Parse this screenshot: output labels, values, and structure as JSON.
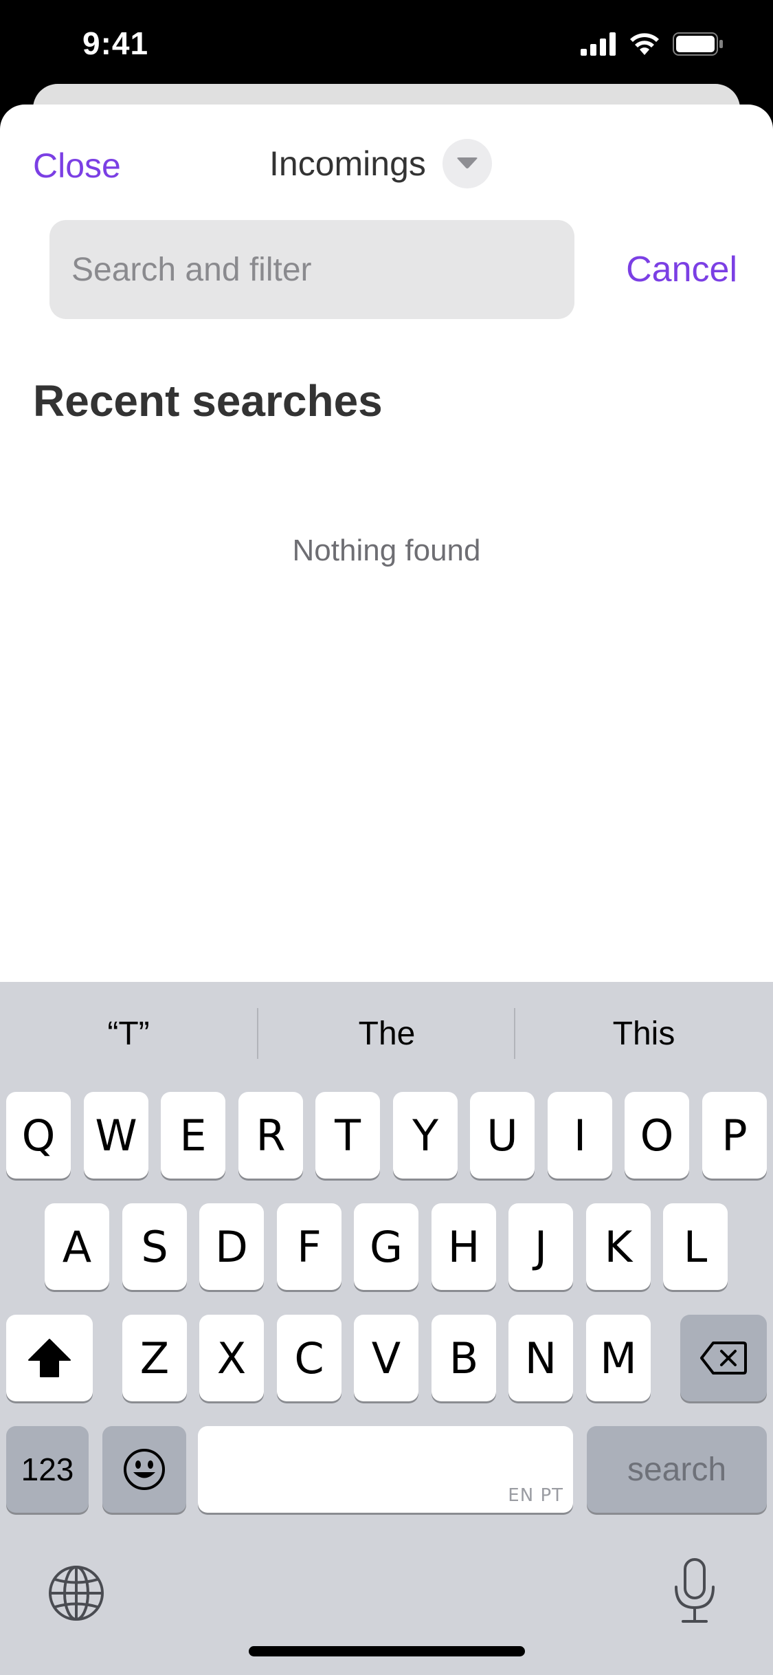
{
  "status_bar": {
    "time": "9:41"
  },
  "header": {
    "close_label": "Close",
    "title": "Incomings"
  },
  "search": {
    "placeholder": "Search and filter",
    "value": "",
    "cancel_label": "Cancel"
  },
  "content": {
    "section_title": "Recent searches",
    "empty_message": "Nothing found"
  },
  "keyboard": {
    "suggestions": [
      "“T”",
      "The",
      "This"
    ],
    "row1": [
      "Q",
      "W",
      "E",
      "R",
      "T",
      "Y",
      "U",
      "I",
      "O",
      "P"
    ],
    "row2": [
      "A",
      "S",
      "D",
      "F",
      "G",
      "H",
      "J",
      "K",
      "L"
    ],
    "row3": [
      "Z",
      "X",
      "C",
      "V",
      "B",
      "N",
      "M"
    ],
    "numbers_label": "123",
    "return_label": "search",
    "space_language": "EN PT"
  },
  "colors": {
    "accent": "#7b3fe4",
    "keyboard_bg": "#d1d3d9"
  }
}
